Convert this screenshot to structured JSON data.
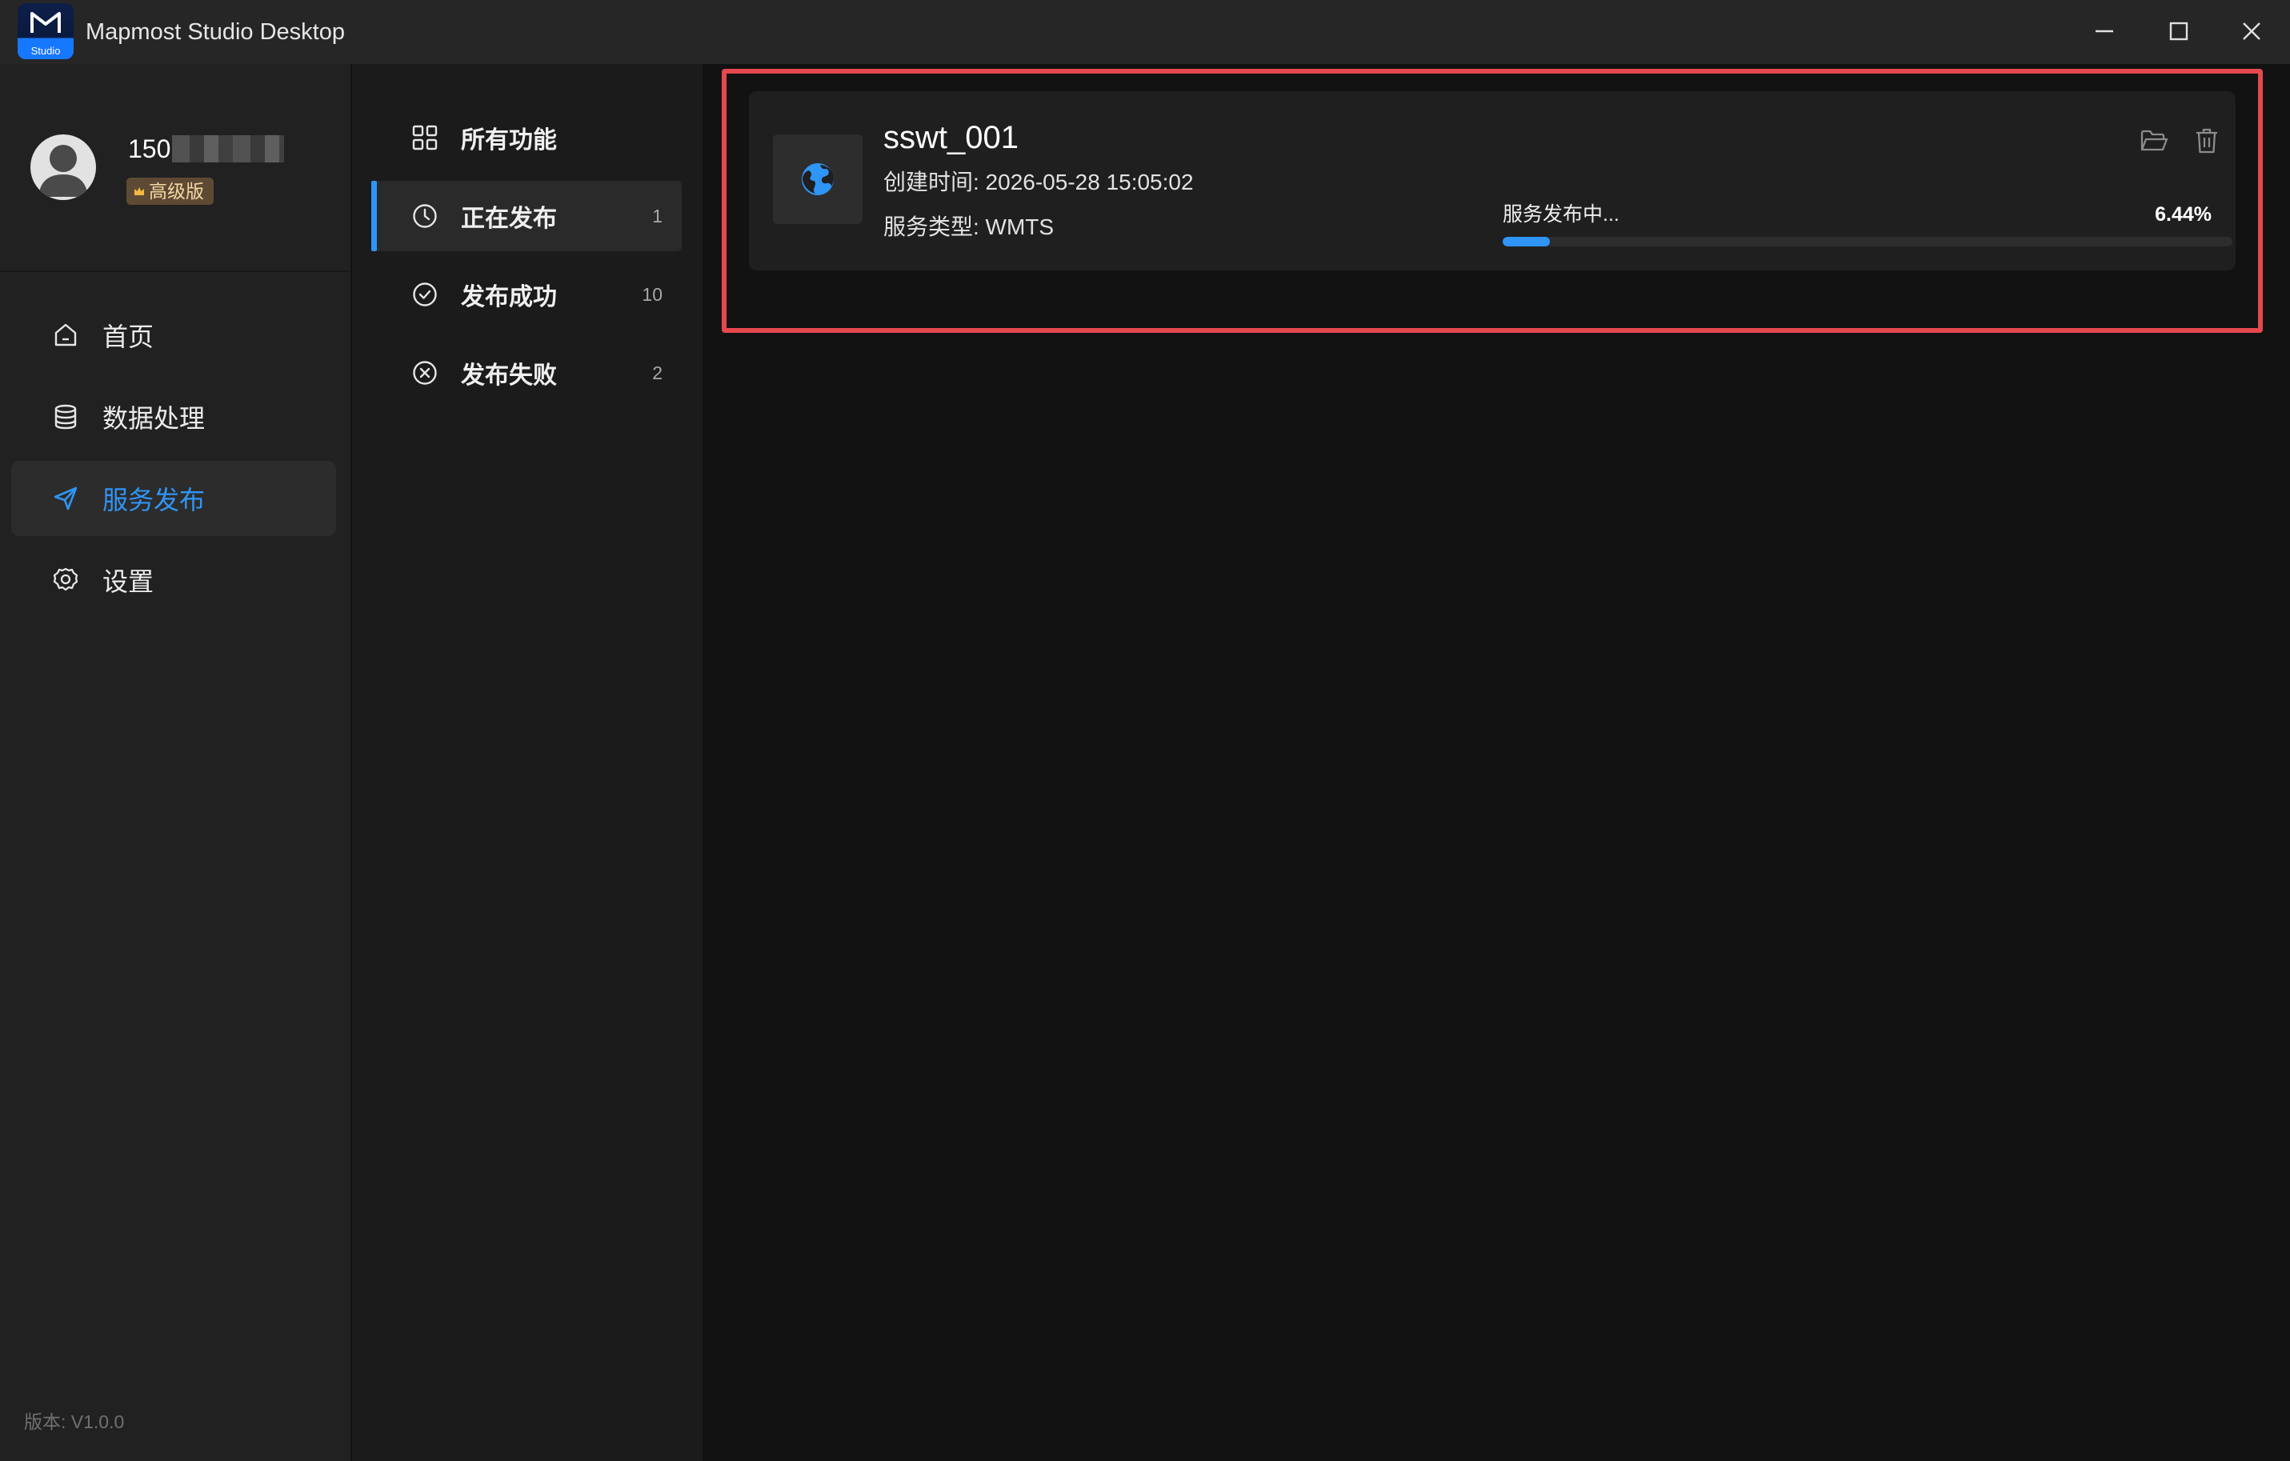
{
  "window": {
    "title": "Mapmost Studio Desktop",
    "logo_sub": "Studio",
    "controls": [
      "minimize-icon",
      "maximize-icon",
      "close-icon"
    ]
  },
  "user": {
    "name_visible": "150",
    "badge": "高级版"
  },
  "sidebar": {
    "items": [
      {
        "label": "首页",
        "icon": "home-icon"
      },
      {
        "label": "数据处理",
        "icon": "database-icon"
      },
      {
        "label": "服务发布",
        "icon": "send-icon",
        "active": true
      },
      {
        "label": "设置",
        "icon": "gear-icon"
      }
    ],
    "version": "版本: V1.0.0"
  },
  "subnav": {
    "items": [
      {
        "label": "所有功能",
        "count": "",
        "icon": "grid-icon"
      },
      {
        "label": "正在发布",
        "count": "1",
        "icon": "clock-icon",
        "active": true
      },
      {
        "label": "发布成功",
        "count": "10",
        "icon": "check-circle-icon"
      },
      {
        "label": "发布失败",
        "count": "2",
        "icon": "x-circle-icon"
      }
    ]
  },
  "task": {
    "name": "sswt_001",
    "created": "创建时间: 2026-05-28 15:05:02",
    "service_type": "服务类型: WMTS",
    "status": "服务发布中...",
    "progress_text": "6.44%",
    "progress": 0.0644,
    "icon": "globe-icon"
  },
  "colors": {
    "accent": "#2f95f6",
    "highlight_border": "#e5484d",
    "badge_bg": "#5e4a34"
  }
}
